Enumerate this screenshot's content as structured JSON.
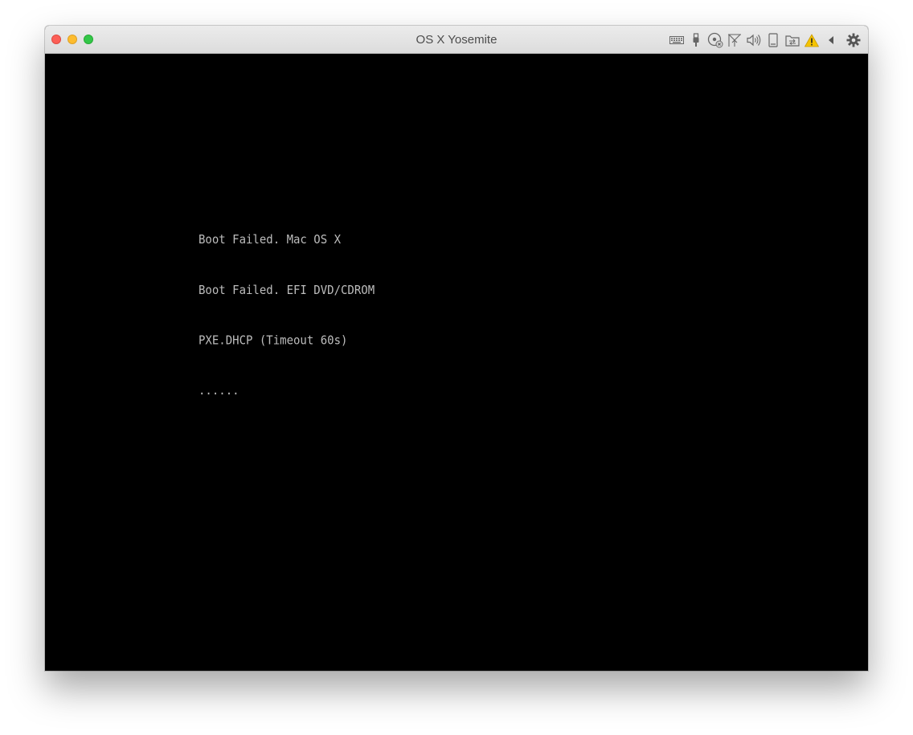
{
  "window": {
    "title": "OS X Yosemite"
  },
  "toolbar": {
    "icons": [
      "keyboard-icon",
      "usb-icon",
      "cd-dvd-icon",
      "network-icon",
      "sound-icon",
      "hard-disk-icon",
      "shared-folders-icon",
      "warning-icon",
      "collapse-arrow-icon",
      "settings-gear-icon"
    ],
    "warning_color": "#f5c400"
  },
  "screen": {
    "background": "#000000",
    "text_color": "#bdbdbd",
    "lines": [
      "Boot Failed. Mac OS X",
      "Boot Failed. EFI DVD/CDROM",
      "PXE.DHCP (Timeout 60s)",
      "......"
    ]
  }
}
